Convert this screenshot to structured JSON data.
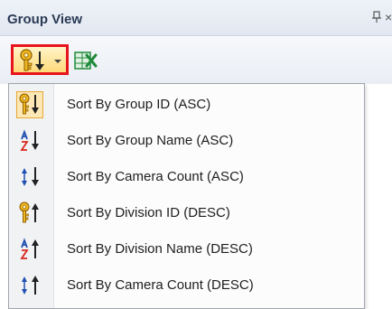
{
  "panel": {
    "title": "Group View",
    "pin_glyph": "̄⊥",
    "close_glyph": "×"
  },
  "toolbar": {
    "sort_button_icon": "key-sort-down-icon",
    "export_button_icon": "excel-export-icon"
  },
  "sort_menu": {
    "items": [
      {
        "label": "Sort By Group ID (ASC)",
        "icon": "key-sort-asc-icon",
        "checked": true
      },
      {
        "label": "Sort By Group Name (ASC)",
        "icon": "az-sort-asc-icon",
        "checked": false
      },
      {
        "label": "Sort By Camera Count (ASC)",
        "icon": "count-sort-asc-icon",
        "checked": false
      },
      {
        "label": "Sort By Division ID (DESC)",
        "icon": "key-sort-desc-icon",
        "checked": false
      },
      {
        "label": "Sort By Division Name (DESC)",
        "icon": "az-sort-desc-icon",
        "checked": false
      },
      {
        "label": "Sort By Camera Count (DESC)",
        "icon": "count-sort-desc-icon",
        "checked": false
      }
    ]
  },
  "colors": {
    "highlight_border": "#e8141c",
    "key_yellow": "#f0b820",
    "accent_blue": "#1f4fb0",
    "accent_red": "#d8281e",
    "excel_green": "#1f8a3a"
  }
}
